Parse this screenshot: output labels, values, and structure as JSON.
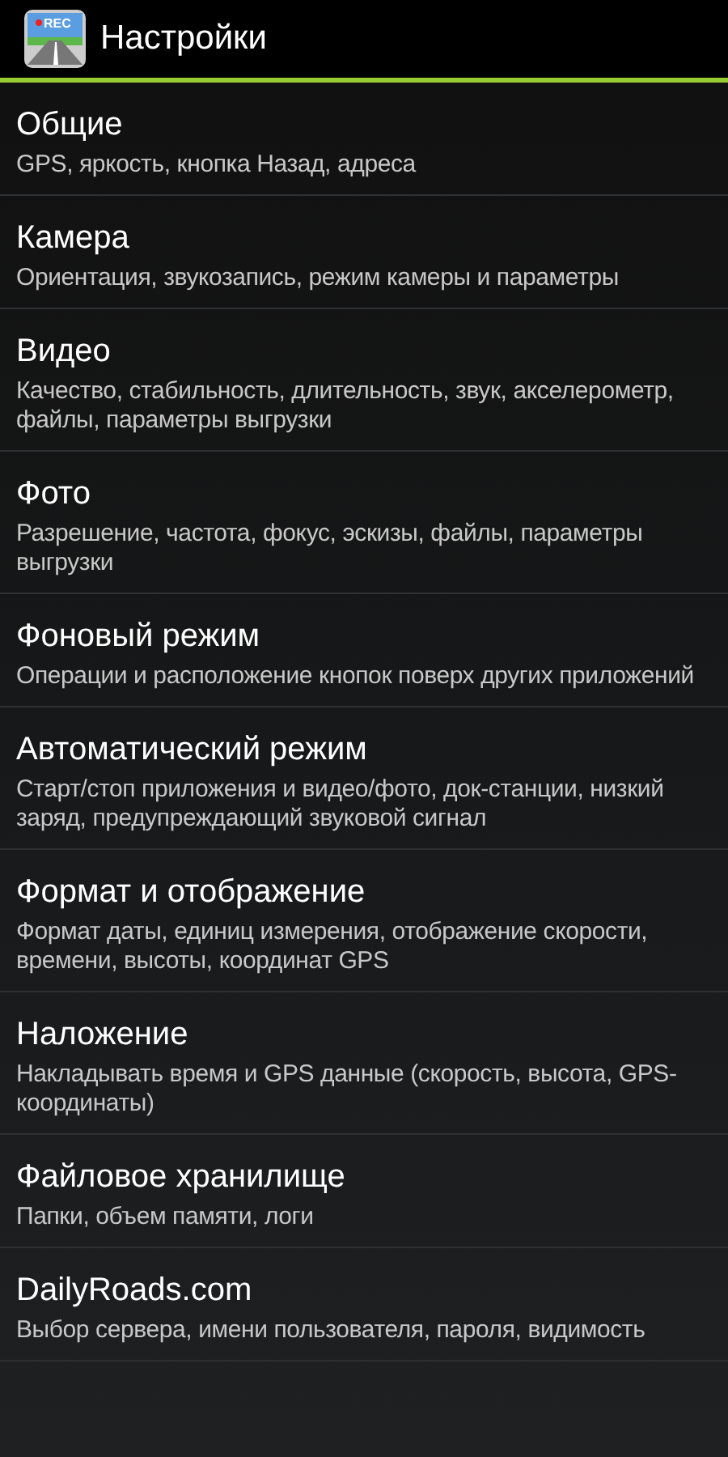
{
  "action_bar": {
    "title": "Настройки",
    "icon_label": "REC"
  },
  "items": [
    {
      "title": "Общие",
      "summary": "GPS, яркость, кнопка Назад, адреса"
    },
    {
      "title": "Камера",
      "summary": "Ориентация, звукозапись, режим камеры и параметры"
    },
    {
      "title": "Видео",
      "summary": "Качество, стабильность, длительность, звук, акселерометр, файлы, параметры выгрузки"
    },
    {
      "title": "Фото",
      "summary": "Разрешение, частота, фокус, эскизы, файлы, параметры выгрузки"
    },
    {
      "title": "Фоновый режим",
      "summary": "Операции и расположение кнопок поверх других приложений"
    },
    {
      "title": "Автоматический режим",
      "summary": "Старт/стоп приложения и видео/фото, док-станции, низкий заряд, предупреждающий звуковой сигнал"
    },
    {
      "title": "Формат и отображение",
      "summary": "Формат даты, единиц измерения, отображение скорости, времени, высоты, координат GPS"
    },
    {
      "title": "Наложение",
      "summary": "Накладывать время и GPS данные (скорость, высота, GPS-координаты)"
    },
    {
      "title": "Файловое хранилище",
      "summary": "Папки, объем памяти, логи"
    },
    {
      "title": "DailyRoads.com",
      "summary": "Выбор сервера, имени пользователя, пароля, видимость"
    }
  ]
}
